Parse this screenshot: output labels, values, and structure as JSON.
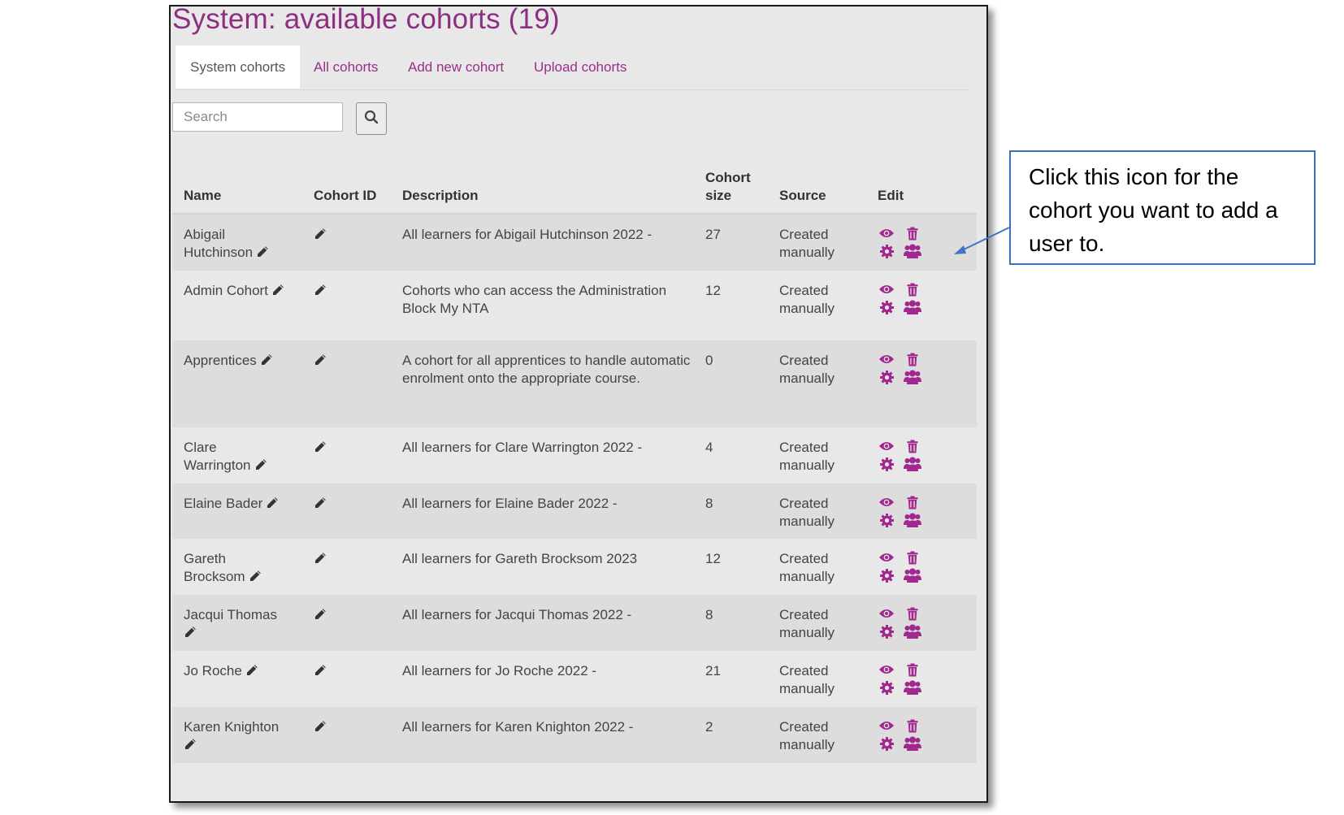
{
  "page": {
    "title": "System: available cohorts (19)"
  },
  "tabs": [
    {
      "label": "System cohorts",
      "active": true
    },
    {
      "label": "All cohorts",
      "active": false
    },
    {
      "label": "Add new cohort",
      "active": false
    },
    {
      "label": "Upload cohorts",
      "active": false
    }
  ],
  "search": {
    "placeholder": "Search",
    "button_icon": "search-icon"
  },
  "table": {
    "headers": {
      "name": "Name",
      "cohort_id": "Cohort ID",
      "description": "Description",
      "cohort_size_line1": "Cohort",
      "cohort_size_line2": "size",
      "source": "Source",
      "edit": "Edit"
    },
    "rows": [
      {
        "name_line1": "Abigail",
        "name_line2": "Hutchinson",
        "description": "All learners for Abigail Hutchinson 2022 -",
        "size": "27",
        "source_line1": "Created",
        "source_line2": "manually"
      },
      {
        "name_line1": "Admin Cohort",
        "name_line2": "",
        "description": "Cohorts who can access the Administration Block My NTA",
        "size": "12",
        "source_line1": "Created",
        "source_line2": "manually"
      },
      {
        "name_line1": "Apprentices",
        "name_line2": "",
        "description": "A cohort for all apprentices to handle automatic enrolment onto the appropriate course.",
        "size": "0",
        "source_line1": "Created",
        "source_line2": "manually"
      },
      {
        "name_line1": "Clare",
        "name_line2": "Warrington",
        "description": "All learners for Clare Warrington 2022 -",
        "size": "4",
        "source_line1": "Created",
        "source_line2": "manually"
      },
      {
        "name_line1": "Elaine Bader",
        "name_line2": "",
        "description": "All learners for Elaine Bader 2022 -",
        "size": "8",
        "source_line1": "Created",
        "source_line2": "manually"
      },
      {
        "name_line1": "Gareth",
        "name_line2": "Brocksom",
        "description": "All learners for Gareth Brocksom 2023",
        "size": "12",
        "source_line1": "Created",
        "source_line2": "manually"
      },
      {
        "name_line1": "Jacqui Thomas",
        "name_line2": "",
        "description": "All learners for Jacqui Thomas 2022 -",
        "size": "8",
        "source_line1": "Created",
        "source_line2": "manually"
      },
      {
        "name_line1": "Jo Roche",
        "name_line2": "",
        "description": "All learners for Jo Roche 2022 -",
        "size": "21",
        "source_line1": "Created",
        "source_line2": "manually"
      },
      {
        "name_line1": "Karen Knighton",
        "name_line2": "",
        "description": "All learners for Karen Knighton 2022 -",
        "size": "2",
        "source_line1": "Created",
        "source_line2": "manually"
      }
    ],
    "row_icons": [
      "edit-pencil-icon",
      "eye-icon",
      "trash-icon",
      "gear-icon",
      "assign-users-icon"
    ]
  },
  "callout": {
    "text": "Click this icon for the cohort you want to add a user to."
  },
  "colors": {
    "accent": "#9a2f8b",
    "title": "#8e2e80",
    "callout_border": "#3f6fb8"
  }
}
